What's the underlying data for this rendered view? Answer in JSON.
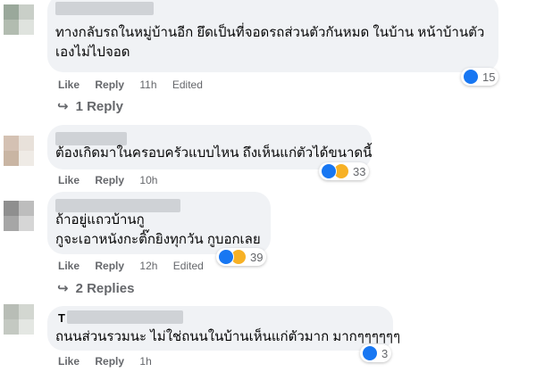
{
  "labels": {
    "like": "Like",
    "reply": "Reply",
    "edited": "Edited"
  },
  "comments": [
    {
      "lines": [
        "ทางกลับรถในหมู่บ้านอีก ยึดเป็นที่จอดรถส่วนตัวกันหมด ในบ้าน หน้าบ้านตัว",
        "เองไม่ไปจอด"
      ],
      "time": "11h",
      "edited": true,
      "reaction_count": "15",
      "reactions": [
        "like"
      ]
    },
    {
      "lines": [
        "ต้องเกิดมาในครอบครัวแบบไหน ถึงเห็นแก่ตัวได้ขนาดนี้"
      ],
      "time": "10h",
      "edited": false,
      "reaction_count": "33",
      "reactions": [
        "like",
        "haha"
      ]
    },
    {
      "lines": [
        "ถ้าอยู่แถวบ้านกู",
        "กูจะเอาหนังกะติ๊กยิงทุกวัน กูบอกเลย"
      ],
      "time": "12h",
      "edited": true,
      "reaction_count": "39",
      "reactions": [
        "like",
        "haha"
      ]
    },
    {
      "name_initial": "T",
      "lines": [
        "ถนนส่วนรวมนะ ไม่ใช่ถนนในบ้านเห็นแก่ตัวมาก มากๆๆๆๆๆๆ"
      ],
      "time": "1h",
      "edited": false,
      "reaction_count": "3",
      "reactions": [
        "like"
      ]
    }
  ],
  "reply_links": [
    "1 Reply",
    "2 Replies"
  ],
  "colors": {
    "bubble": "#f0f2f5",
    "like_blue": "#1877f2",
    "haha_yellow": "#f7b125",
    "meta_gray": "#65676b"
  }
}
